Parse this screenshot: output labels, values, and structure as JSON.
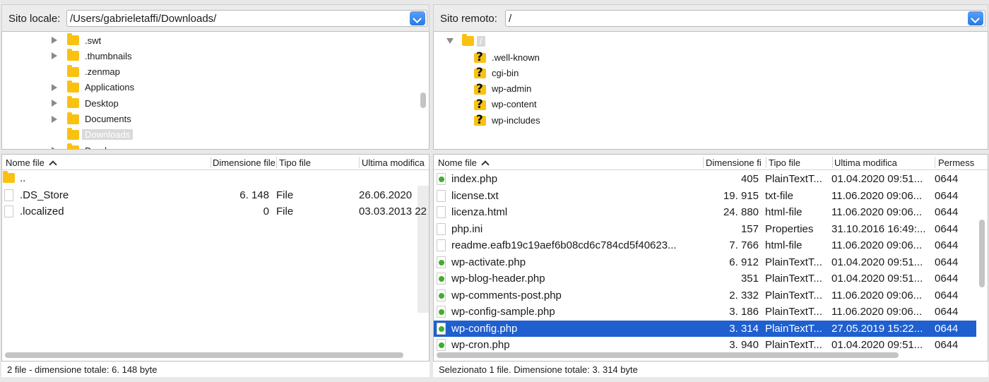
{
  "local": {
    "label": "Sito locale:",
    "path": "/Users/gabrieletaffi/Downloads/",
    "tree": [
      {
        "name": ".swt",
        "expand": true
      },
      {
        "name": ".thumbnails",
        "expand": true
      },
      {
        "name": ".zenmap",
        "expand": false
      },
      {
        "name": "Applications",
        "expand": true
      },
      {
        "name": "Desktop",
        "expand": true
      },
      {
        "name": "Documents",
        "expand": true
      },
      {
        "name": "Downloads",
        "expand": false,
        "selected": true
      },
      {
        "name": "Dropbox",
        "expand": true
      }
    ],
    "columns": [
      "Nome file",
      "Dimensione file",
      "Tipo file",
      "Ultima modifica"
    ],
    "files": [
      {
        "name": "..",
        "size": "",
        "type": "",
        "modified": "",
        "icon": "folder"
      },
      {
        "name": ".DS_Store",
        "size": "6. 148",
        "type": "File",
        "modified": "26.06.2020",
        "icon": "doc"
      },
      {
        "name": ".localized",
        "size": "0",
        "type": "File",
        "modified": "03.03.2013 22",
        "icon": "doc"
      }
    ],
    "status": "2 file - dimensione totale: 6. 148 byte"
  },
  "remote": {
    "label": "Sito remoto:",
    "path": "/",
    "root": "/",
    "tree": [
      {
        "name": ".well-known"
      },
      {
        "name": "cgi-bin"
      },
      {
        "name": "wp-admin"
      },
      {
        "name": "wp-content"
      },
      {
        "name": "wp-includes"
      }
    ],
    "columns": [
      "Nome file",
      "Dimensione fi",
      "Tipo file",
      "Ultima modifica",
      "Permess"
    ],
    "files": [
      {
        "name": "index.php",
        "size": "405",
        "type": "PlainTextT...",
        "modified": "01.04.2020 09:51...",
        "perm": "0644",
        "icon": "php"
      },
      {
        "name": "license.txt",
        "size": "19. 915",
        "type": "txt-file",
        "modified": "11.06.2020 09:06...",
        "perm": "0644",
        "icon": "doc"
      },
      {
        "name": "licenza.html",
        "size": "24. 880",
        "type": "html-file",
        "modified": "11.06.2020 09:06...",
        "perm": "0644",
        "icon": "doc"
      },
      {
        "name": "php.ini",
        "size": "157",
        "type": "Properties",
        "modified": "31.10.2016 16:49:...",
        "perm": "0644",
        "icon": "doc"
      },
      {
        "name": "readme.eafb19c19aef6b08cd6c784cd5f40623...",
        "size": "7. 766",
        "type": "html-file",
        "modified": "11.06.2020 09:06...",
        "perm": "0644",
        "icon": "doc"
      },
      {
        "name": "wp-activate.php",
        "size": "6. 912",
        "type": "PlainTextT...",
        "modified": "01.04.2020 09:51...",
        "perm": "0644",
        "icon": "php"
      },
      {
        "name": "wp-blog-header.php",
        "size": "351",
        "type": "PlainTextT...",
        "modified": "01.04.2020 09:51...",
        "perm": "0644",
        "icon": "php"
      },
      {
        "name": "wp-comments-post.php",
        "size": "2. 332",
        "type": "PlainTextT...",
        "modified": "11.06.2020 09:06...",
        "perm": "0644",
        "icon": "php"
      },
      {
        "name": "wp-config-sample.php",
        "size": "3. 186",
        "type": "PlainTextT...",
        "modified": "11.06.2020 09:06...",
        "perm": "0644",
        "icon": "php"
      },
      {
        "name": "wp-config.php",
        "size": "3. 314",
        "type": "PlainTextT...",
        "modified": "27.05.2019 15:22...",
        "perm": "0644",
        "icon": "php",
        "selected": true
      },
      {
        "name": "wp-cron.php",
        "size": "3. 940",
        "type": "PlainTextT...",
        "modified": "01.04.2020 09:51...",
        "perm": "0644",
        "icon": "php"
      }
    ],
    "status": "Selezionato 1 file. Dimensione totale: 3. 314 byte"
  },
  "colors": {
    "selection": "#1f5fcf",
    "folder": "#f9c212",
    "php_icon": "#3fae2a"
  }
}
